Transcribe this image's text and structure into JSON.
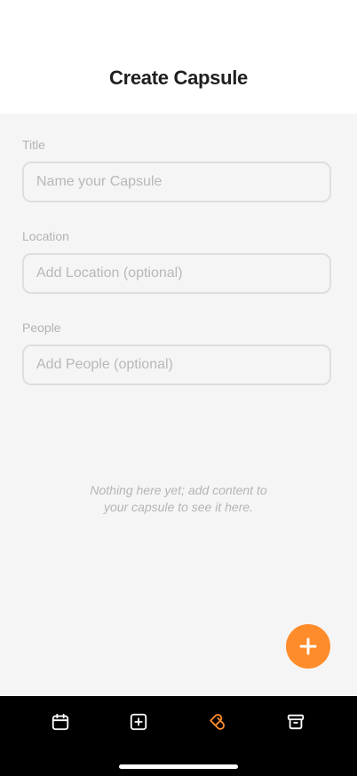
{
  "header": {
    "title": "Create Capsule"
  },
  "form": {
    "title_label": "Title",
    "title_placeholder": "Name your Capsule",
    "location_label": "Location",
    "location_placeholder": "Add Location (optional)",
    "people_label": "People",
    "people_placeholder": "Add People (optional)"
  },
  "empty_state": {
    "message": "Nothing here yet; add content to your capsule to see it here."
  },
  "fab": {
    "icon": "plus-icon",
    "color": "#ff8c2b"
  },
  "tabbar": {
    "items": [
      {
        "icon": "calendar-icon",
        "active": false
      },
      {
        "icon": "plus-square-icon",
        "active": false
      },
      {
        "icon": "capsule-icon",
        "active": true
      },
      {
        "icon": "archive-icon",
        "active": false
      }
    ],
    "active_color": "#ff8c2b",
    "inactive_color": "#ffffff"
  }
}
